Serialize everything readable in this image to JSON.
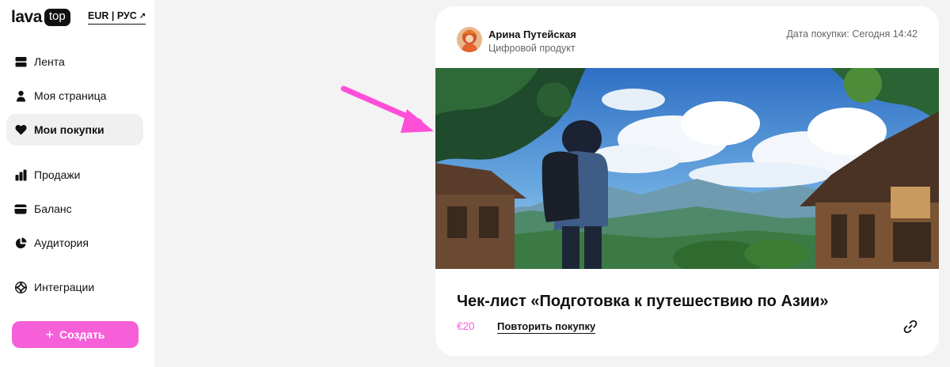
{
  "brand": {
    "logo_text": "lava",
    "logo_badge": "top"
  },
  "language_switcher": {
    "label": "EUR | РУС",
    "arrow": "↗"
  },
  "sidebar": {
    "items": [
      {
        "label": "Лента",
        "icon": "feed-icon",
        "active": false
      },
      {
        "label": "Моя страница",
        "icon": "user-icon",
        "active": false
      },
      {
        "label": "Мои покупки",
        "icon": "heart-icon",
        "active": true
      },
      {
        "label": "Продажи",
        "icon": "bar-chart-icon",
        "active": false
      },
      {
        "label": "Баланс",
        "icon": "card-icon",
        "active": false
      },
      {
        "label": "Аудитория",
        "icon": "pie-chart-icon",
        "active": false
      },
      {
        "label": "Интеграции",
        "icon": "integrations-icon",
        "active": false
      }
    ],
    "create_button": {
      "label": "Создать",
      "plus": "+"
    }
  },
  "purchase_card": {
    "seller_name": "Арина Путейская",
    "product_type": "Цифровой продукт",
    "purchase_date": "Дата покупки: Сегодня 14:42",
    "title": "Чек-лист «Подготовка к путешествию по Азии»",
    "price": "€20",
    "repeat_label": "Повторить покупку",
    "link_icon": "link-icon"
  },
  "colors": {
    "accent": "#f55fd8",
    "active_bg": "#f0f0f0",
    "page_bg": "#f3f3f3"
  }
}
